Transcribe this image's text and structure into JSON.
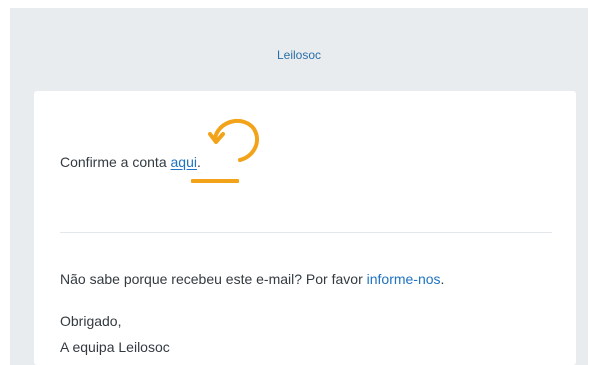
{
  "email": {
    "brand": "Leilosoc",
    "confirm_text": "Confirme a conta ",
    "confirm_link": "aqui",
    "confirm_period": ".",
    "question_text": "Não sabe porque recebeu este e-mail? Por favor ",
    "report_link": "informe-nos",
    "question_period": ".",
    "thanks": "Obrigado,",
    "team": "A equipa Leilosoc"
  },
  "colors": {
    "background": "#e9ecef",
    "link": "#1f73c1",
    "annotation": "#f2a31a"
  },
  "annotation": {
    "icon": "curved-arrow-icon"
  }
}
